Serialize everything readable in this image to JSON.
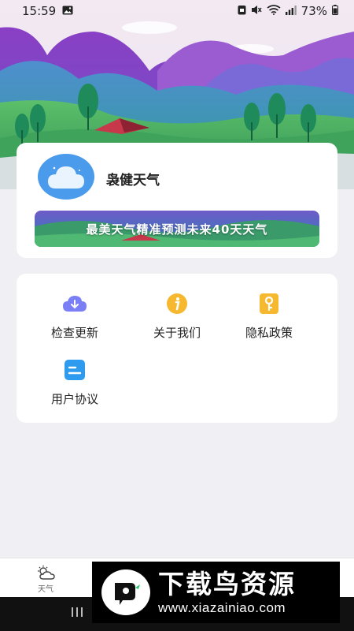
{
  "status_bar": {
    "time": "15:59",
    "battery": "73%"
  },
  "app": {
    "name": "袅健天气",
    "banner_text": "最美天气精准预测未来40天天气"
  },
  "menu": {
    "items": [
      {
        "label": "检查更新",
        "icon": "cloud-download-icon",
        "color": "#7b7ff5"
      },
      {
        "label": "关于我们",
        "icon": "info-icon",
        "color": "#f5b82e"
      },
      {
        "label": "隐私政策",
        "icon": "key-icon",
        "color": "#f5b82e"
      },
      {
        "label": "用户协议",
        "icon": "document-icon",
        "color": "#2f9bef"
      }
    ]
  },
  "bottom_nav": {
    "items": [
      {
        "label": "天气",
        "icon": "weather-icon"
      }
    ]
  },
  "watermark": {
    "title": "下载鸟资源",
    "url": "www.xiazainiao.com"
  },
  "colors": {
    "page_bg": "#f0eff4",
    "logo_blue": "#4a9bec"
  }
}
